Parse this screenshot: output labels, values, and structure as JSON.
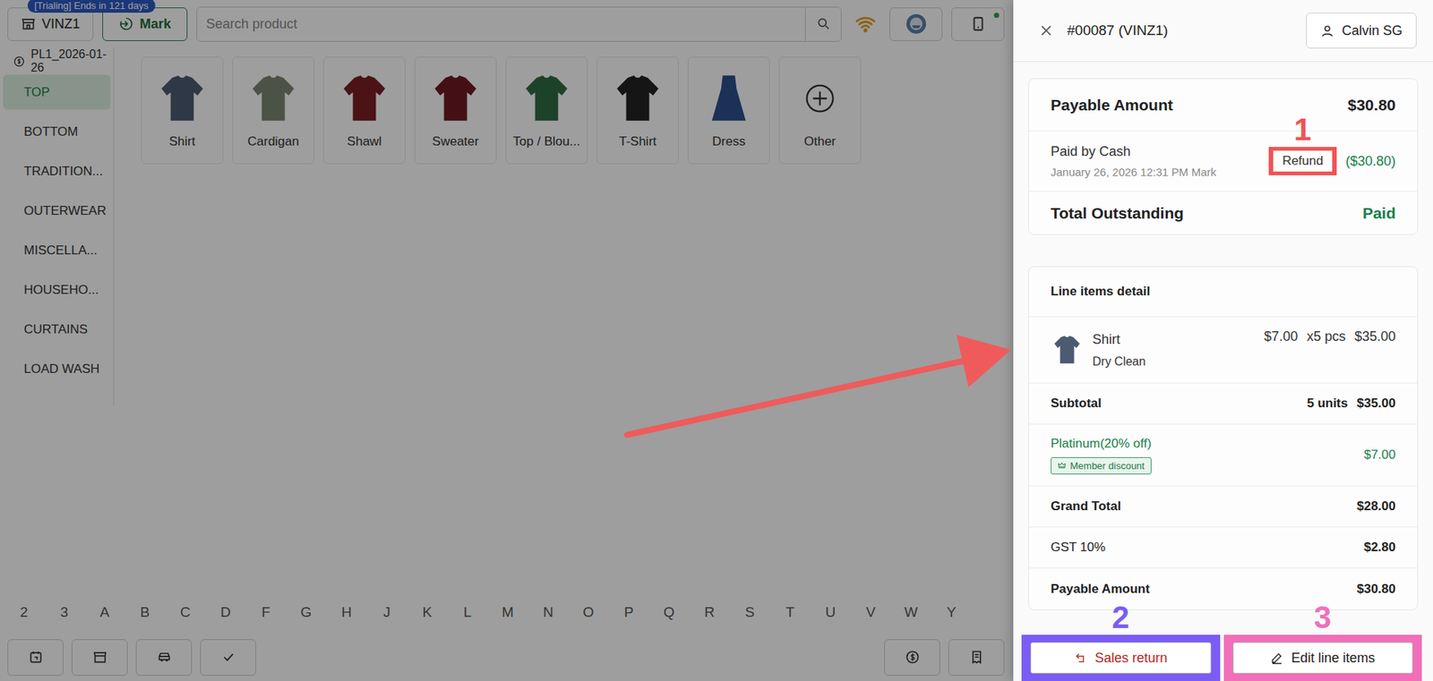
{
  "topbar": {
    "trial_badge": "[Trialing] Ends in 121 days",
    "store": "VINZ1",
    "user_button": "Mark",
    "search_placeholder": "Search product",
    "wifi_connected": true,
    "device_online": true
  },
  "price_list": "PL1_2026-01-26",
  "categories": [
    {
      "label": "TOP",
      "selected": true
    },
    {
      "label": "BOTTOM",
      "selected": false
    },
    {
      "label": "TRADITION...",
      "selected": false
    },
    {
      "label": "OUTERWEAR",
      "selected": false
    },
    {
      "label": "MISCELLA...",
      "selected": false
    },
    {
      "label": "HOUSEHO...",
      "selected": false
    },
    {
      "label": "CURTAINS",
      "selected": false
    },
    {
      "label": "LOAD WASH",
      "selected": false
    }
  ],
  "products": [
    {
      "label": "Shirt",
      "kind": "top",
      "color": "#4b5b72"
    },
    {
      "label": "Cardigan",
      "kind": "top",
      "color": "#7d8572"
    },
    {
      "label": "Shawl",
      "kind": "top",
      "color": "#7a1f25"
    },
    {
      "label": "Sweater",
      "kind": "top",
      "color": "#6e1a22"
    },
    {
      "label": "Top / Blou...",
      "kind": "top",
      "color": "#2f6b45"
    },
    {
      "label": "T-Shirt",
      "kind": "top",
      "color": "#222222"
    },
    {
      "label": "Dress",
      "kind": "dress",
      "color": "#2c4f8c"
    },
    {
      "label": "Other",
      "kind": "add",
      "color": "#333333"
    }
  ],
  "alphabet": [
    "2",
    "3",
    "A",
    "B",
    "C",
    "D",
    "F",
    "G",
    "H",
    "J",
    "K",
    "L",
    "M",
    "N",
    "O",
    "P",
    "Q",
    "R",
    "S",
    "T",
    "U",
    "V",
    "W",
    "Y"
  ],
  "drawer": {
    "order_title": "#00087 (VINZ1)",
    "customer": "Calvin SG",
    "payment": {
      "payable_label": "Payable Amount",
      "payable_value": "$30.80",
      "payments": [
        {
          "method": "Paid by Cash",
          "meta": "January 26, 2026 12:31 PM Mark",
          "action": {
            "label": "Refund",
            "marker": {
              "number": "1",
              "color": "#f05454"
            }
          },
          "amount": "($30.80)"
        }
      ],
      "outstanding_label": "Total Outstanding",
      "outstanding_value": "Paid"
    },
    "line_items": {
      "title": "Line items detail",
      "items": [
        {
          "name": "Shirt",
          "service": "Dry Clean",
          "unit_price": "$7.00",
          "qty": "x5 pcs",
          "total": "$35.00",
          "color": "#4b5b72"
        }
      ],
      "summary": [
        {
          "label": "Subtotal",
          "units": "5 units",
          "value": "$35.00",
          "kind": "total"
        },
        {
          "label": "Platinum(20% off)",
          "badge": "Member discount",
          "value": "$7.00",
          "kind": "discount"
        },
        {
          "label": "Grand Total",
          "value": "$28.00",
          "kind": "total"
        },
        {
          "label": "GST 10%",
          "value": "$2.80",
          "kind": "tax"
        },
        {
          "label": "Payable Amount",
          "value": "$30.80",
          "kind": "total"
        }
      ]
    },
    "actions": [
      {
        "label": "Sales return",
        "kind": "danger",
        "marker": {
          "number": "2",
          "color": "#7b5cf5"
        }
      },
      {
        "label": "Edit line items",
        "kind": "default",
        "marker": {
          "number": "3",
          "color": "#f06fb8"
        }
      }
    ]
  }
}
